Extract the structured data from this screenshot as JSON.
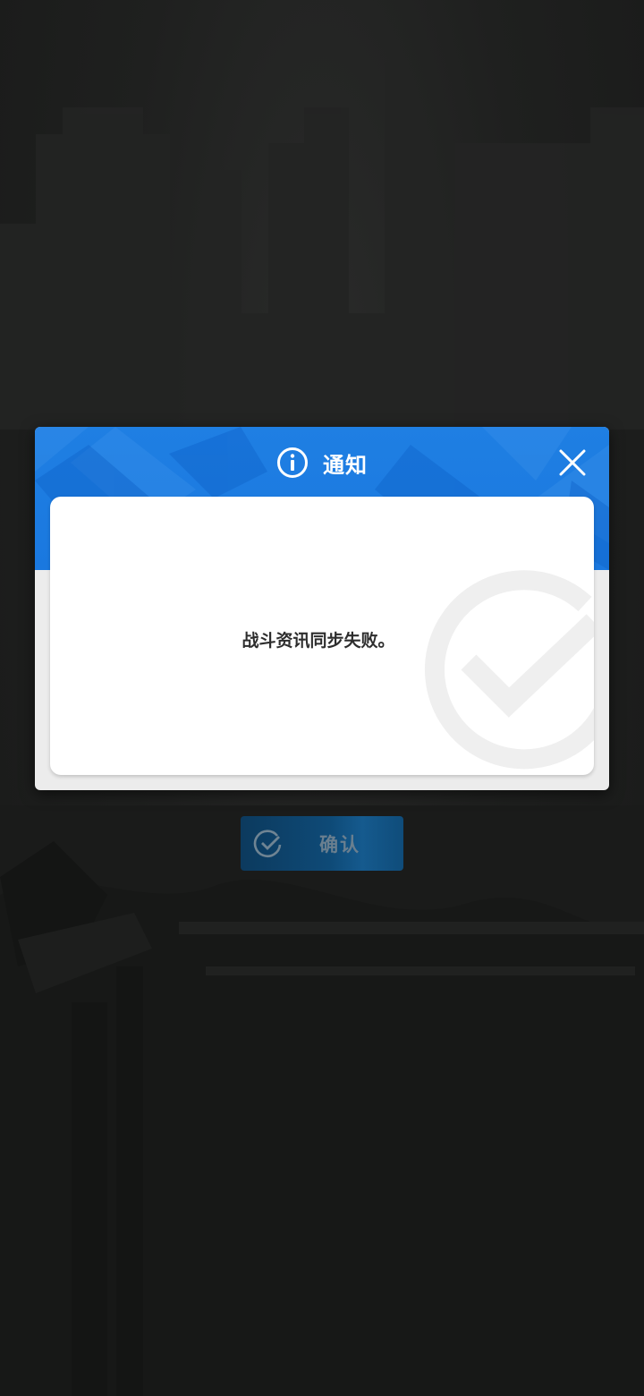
{
  "dialog": {
    "title": "通知",
    "title_icon": "info-icon",
    "close_icon": "close-icon",
    "message": "战斗资讯同步失败。",
    "watermark_icon": "checkmark-circle-icon"
  },
  "confirm": {
    "label": "确认",
    "icon": "check-circle-icon"
  },
  "colors": {
    "header_blue": "#1a78df",
    "confirm_button": "#0e4a77",
    "backdrop": "#1b1c1c"
  }
}
